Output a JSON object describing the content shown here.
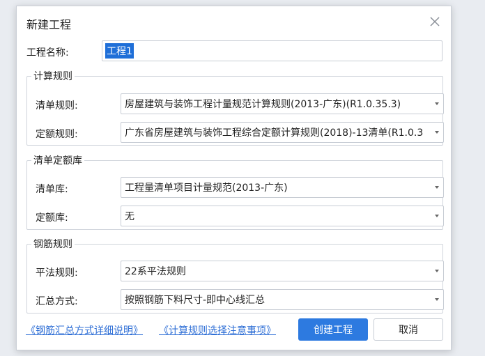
{
  "dialog": {
    "title": "新建工程",
    "close_icon": "close-icon"
  },
  "project_name": {
    "label": "工程名称:",
    "value": "工程1"
  },
  "calc_rules": {
    "legend": "计算规则",
    "list_rule_label": "清单规则:",
    "list_rule_value": "房屋建筑与装饰工程计量规范计算规则(2013-广东)(R1.0.35.3)",
    "quota_rule_label": "定额规则:",
    "quota_rule_value": "广东省房屋建筑与装饰工程综合定额计算规则(2018)-13清单(R1.0.3"
  },
  "library": {
    "legend": "清单定额库",
    "list_lib_label": "清单库:",
    "list_lib_value": "工程量清单项目计量规范(2013-广东)",
    "quota_lib_label": "定额库:",
    "quota_lib_value": "无"
  },
  "rebar": {
    "legend": "钢筋规则",
    "flat_rule_label": "平法规则:",
    "flat_rule_value": "22系平法规则",
    "summary_label": "汇总方式:",
    "summary_value": "按照钢筋下料尺寸-即中心线汇总"
  },
  "footer": {
    "link_rebar": "《钢筋汇总方式详细说明》",
    "link_calc": "《计算规则选择注意事项》",
    "create_button": "创建工程",
    "cancel_button": "取消"
  },
  "colors": {
    "primary": "#2d7ae0",
    "link": "#2f6fd6",
    "selection": "#1f6fd8"
  }
}
